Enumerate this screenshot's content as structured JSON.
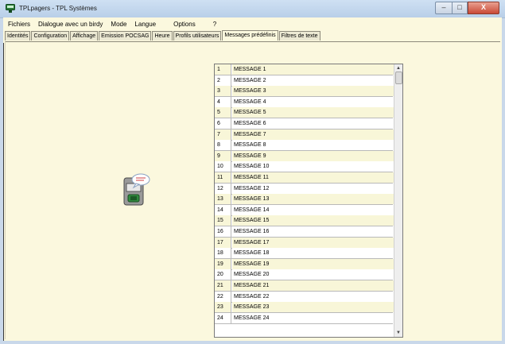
{
  "window": {
    "title": "TPLpagers - TPL Systèmes",
    "minimize": "–",
    "maximize": "□",
    "close": "X"
  },
  "menu": [
    "Fichiers",
    "Dialogue avec un birdy",
    "Mode",
    "Langue",
    "Options",
    "?"
  ],
  "tabs": [
    "Identités",
    "Configuration",
    "Affichage",
    "Emission POCSAG",
    "Heure",
    "Profils utilisateurs",
    "Messages prédéfinis",
    "Filtres de texte"
  ],
  "active_tab": "Messages prédéfinis",
  "messages": [
    {
      "n": "1",
      "text": "MESSAGE 1"
    },
    {
      "n": "2",
      "text": "MESSAGE 2"
    },
    {
      "n": "3",
      "text": "MESSAGE 3"
    },
    {
      "n": "4",
      "text": "MESSAGE 4"
    },
    {
      "n": "5",
      "text": "MESSAGE 5"
    },
    {
      "n": "6",
      "text": "MESSAGE 6"
    },
    {
      "n": "7",
      "text": "MESSAGE 7"
    },
    {
      "n": "8",
      "text": "MESSAGE 8"
    },
    {
      "n": "9",
      "text": "MESSAGE 9"
    },
    {
      "n": "10",
      "text": "MESSAGE 10"
    },
    {
      "n": "11",
      "text": "MESSAGE 11"
    },
    {
      "n": "12",
      "text": "MESSAGE 12"
    },
    {
      "n": "13",
      "text": "MESSAGE 13"
    },
    {
      "n": "14",
      "text": "MESSAGE 14"
    },
    {
      "n": "15",
      "text": "MESSAGE 15"
    },
    {
      "n": "16",
      "text": "MESSAGE 16"
    },
    {
      "n": "17",
      "text": "MESSAGE 17"
    },
    {
      "n": "18",
      "text": "MESSAGE 18"
    },
    {
      "n": "19",
      "text": "MESSAGE 19"
    },
    {
      "n": "20",
      "text": "MESSAGE 20"
    },
    {
      "n": "21",
      "text": "MESSAGE 21"
    },
    {
      "n": "22",
      "text": "MESSAGE 22"
    },
    {
      "n": "23",
      "text": "MESSAGE 23"
    },
    {
      "n": "24",
      "text": "MESSAGE 24"
    }
  ],
  "icons": {
    "app": "pager-app-icon",
    "device": "pager-device-icon",
    "scroll_up": "scroll-up-icon",
    "scroll_down": "scroll-down-icon"
  },
  "colors": {
    "client_bg": "#fbf8de",
    "row_alt": "#f8f6d8",
    "row_plain": "#ffffff",
    "close_button": "#c94a36"
  }
}
